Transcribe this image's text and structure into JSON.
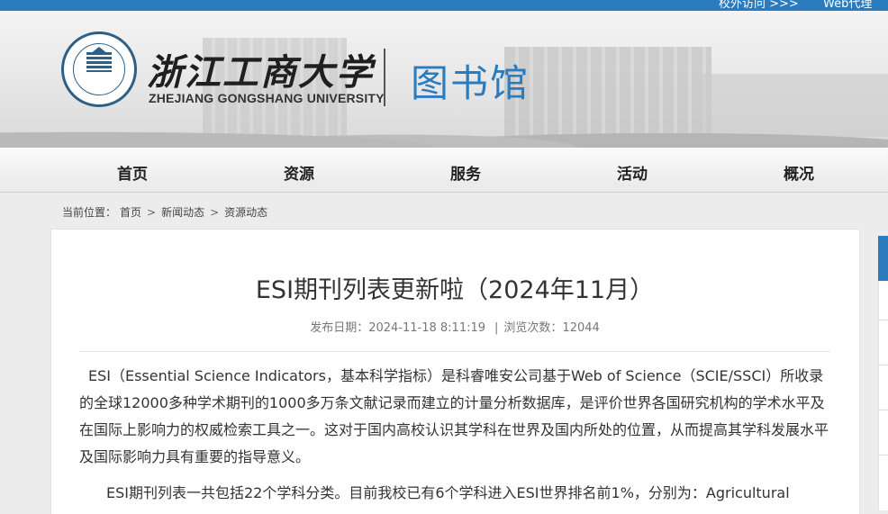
{
  "top_links": [
    "校外访问 >>>",
    "Web代理"
  ],
  "header": {
    "university_cn": "浙江工商大学",
    "university_en": "ZHEJIANG GONGSHANG UNIVERSITY",
    "library_title": "图书馆",
    "seal_text": "ZHEJIANG GONGSHANG UNIVERSITY 1911 浙江工商大学"
  },
  "nav": {
    "items": [
      "首页",
      "资源",
      "服务",
      "活动",
      "概况"
    ]
  },
  "breadcrumb": {
    "prefix": "当前位置：",
    "items": [
      "首页",
      "新闻动态",
      "资源动态"
    ],
    "separator": ">"
  },
  "article": {
    "title": "ESI期刊列表更新啦（2024年11月）",
    "date_label": "发布日期：2024-11-18 8:11:19",
    "divider": "|",
    "views_label": "浏览次数：12044",
    "paragraphs": [
      "ESI（Essential Science Indicators，基本科学指标）是科睿唯安公司基于Web of Science（SCIE/SSCI）所收录的全球12000多种学术期刊的1000多万条文献记录而建立的计量分析数据库，是评价世界各国研究机构的学术水平及在国际上影响力的权威检索工具之一。这对于国内高校认识其学科在世界及国内所处的位置，从而提高其学科发展水平及国际影响力具有重要的指导意义。",
      "ESI期刊列表一共包括22个学科分类。目前我校已有6个学科进入ESI世界排名前1%，分别为：Agricultural"
    ]
  },
  "colors": {
    "accent": "#2b7bbf",
    "nav_bg": "#eeeeee",
    "text": "#333333"
  }
}
